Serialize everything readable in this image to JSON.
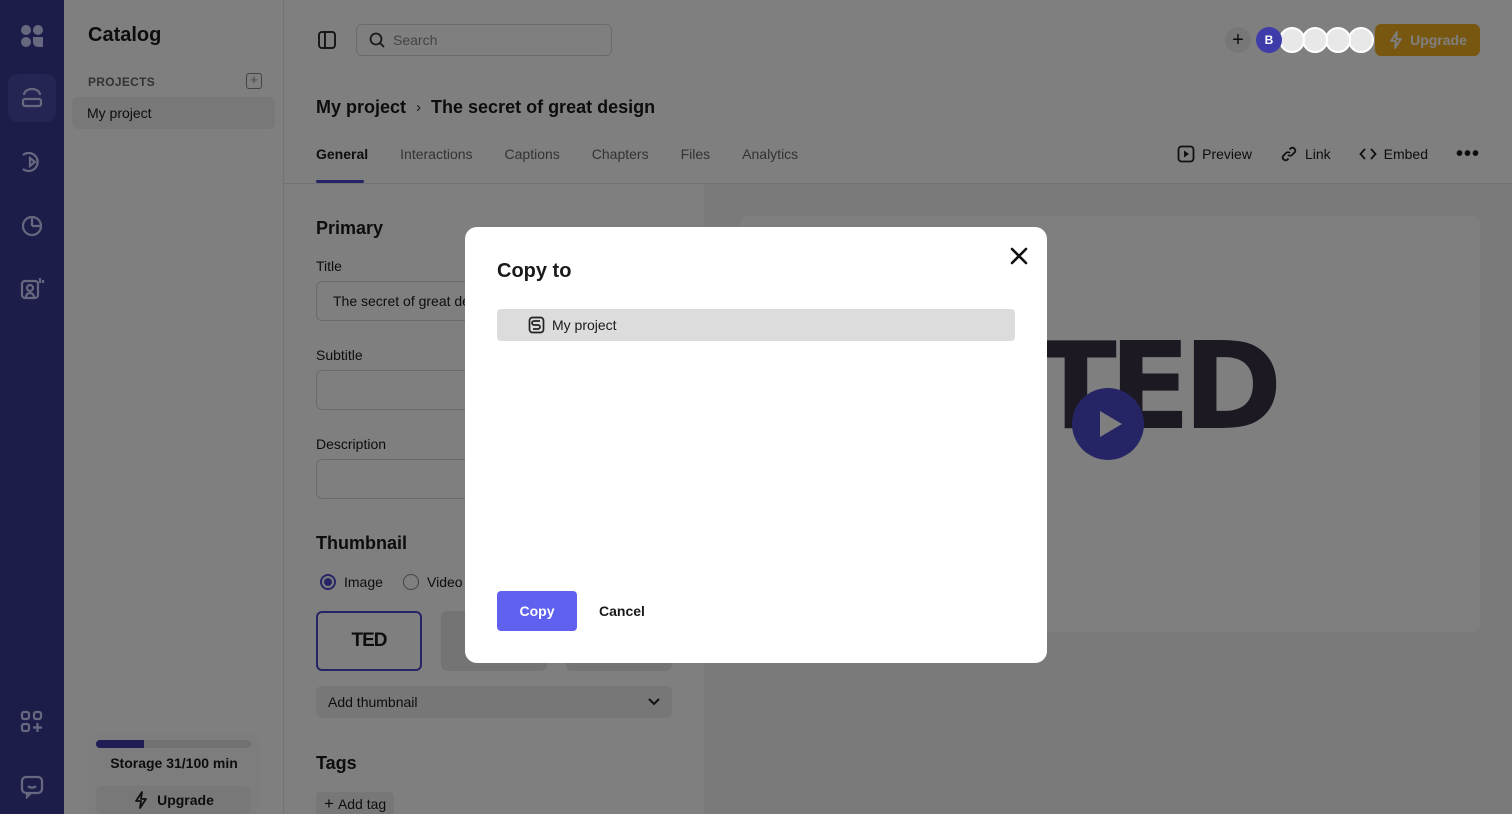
{
  "sidebar": {
    "title": "Catalog",
    "section_label": "PROJECTS",
    "project_item": "My project",
    "storage_label": "Storage 31/100 min",
    "storage_used_fraction": 0.31,
    "upgrade_label": "Upgrade"
  },
  "topbar": {
    "search_placeholder": "Search",
    "avatar_initial": "B",
    "upgrade_label": "Upgrade"
  },
  "breadcrumb": {
    "project": "My project",
    "separator": "›",
    "video": "The secret of great design"
  },
  "tabs": [
    "General",
    "Interactions",
    "Captions",
    "Chapters",
    "Files",
    "Analytics"
  ],
  "actions": {
    "preview": "Preview",
    "link": "Link",
    "embed": "Embed",
    "more": "•••"
  },
  "form": {
    "primary_heading": "Primary",
    "title_label": "Title",
    "title_value": "The secret of great de",
    "subtitle_label": "Subtitle",
    "description_label": "Description",
    "thumbnail_heading": "Thumbnail",
    "radio_image": "Image",
    "radio_video": "Video",
    "thumb_logo": "TED",
    "add_thumbnail": "Add thumbnail",
    "tags_heading": "Tags",
    "add_tag": "Add tag"
  },
  "preview": {
    "logo_text": "TED"
  },
  "modal": {
    "title": "Copy to",
    "item": "My project",
    "copy_label": "Copy",
    "cancel_label": "Cancel"
  },
  "colors": {
    "rail": "#3b3a94",
    "accent": "#4a48c8",
    "copy_button": "#6161f0",
    "upgrade": "#f0b022"
  }
}
